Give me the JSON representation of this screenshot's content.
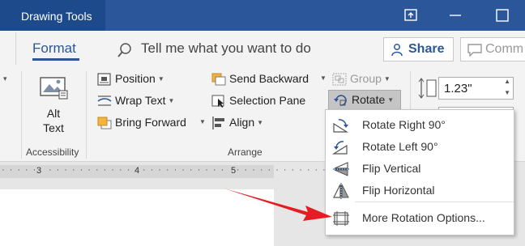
{
  "titlebar": {
    "context_tab": "Drawing Tools"
  },
  "tabs": {
    "format": "Format",
    "tell_me": "Tell me what you want to do",
    "share": "Share",
    "comments": "Comm"
  },
  "ribbon": {
    "alt_text": {
      "line1": "Alt",
      "line2": "Text"
    },
    "accessibility_label": "Accessibility",
    "arrange_label": "Arrange",
    "position": "Position",
    "wrap_text": "Wrap Text",
    "bring_forward": "Bring Forward",
    "send_backward": "Send Backward",
    "selection_pane": "Selection Pane",
    "align": "Align",
    "group": "Group",
    "rotate": "Rotate",
    "height_value": "1.23\""
  },
  "ruler": {
    "marks": [
      "3",
      "4",
      "5"
    ]
  },
  "rotate_menu": {
    "items": [
      "Rotate Right 90°",
      "Rotate Left 90°",
      "Flip Vertical",
      "Flip Horizontal",
      "More Rotation Options..."
    ]
  },
  "colors": {
    "accent": "#2b579a",
    "arrow": "#e51c23"
  }
}
